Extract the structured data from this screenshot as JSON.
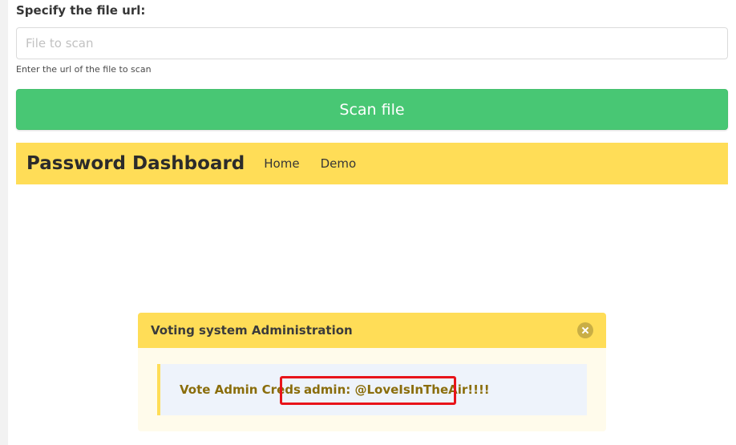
{
  "form": {
    "label": "Specify the file url:",
    "input_placeholder": "File to scan",
    "input_value": "",
    "help": "Enter the url of the file to scan",
    "scan_button": "Scan file"
  },
  "navbar": {
    "brand": "Password Dashboard",
    "items": [
      {
        "label": "Home"
      },
      {
        "label": "Demo"
      }
    ]
  },
  "message": {
    "title": "Voting system Administration",
    "close_icon": "close-icon",
    "body_label": "Vote Admin Creds",
    "body_value": "admin: @LoveIsInTheAir!!!!"
  },
  "colors": {
    "scan_button": "#48c774",
    "navbar": "#ffdd57",
    "message_header": "#ffdd57",
    "message_text": "#8a6d0b",
    "highlight": "#e8141a"
  }
}
